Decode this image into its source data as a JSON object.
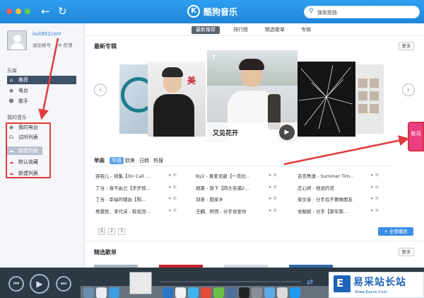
{
  "window": {
    "title": "酷狗音乐",
    "logo_letter": "K",
    "search_placeholder": "搜索歌曲"
  },
  "user": {
    "name": "liuli952com",
    "logout": "退出帐号",
    "feedback": "反馈"
  },
  "sidebar": {
    "library_title": "乐库",
    "library_items": [
      {
        "label": "推荐",
        "icon": "home-icon"
      },
      {
        "label": "电台",
        "icon": "radio-icon"
      },
      {
        "label": "歌手",
        "icon": "singer-icon"
      }
    ],
    "music_title": "我的音乐",
    "music_items": [
      {
        "label": "我的电台",
        "icon": "radio-icon"
      },
      {
        "label": "试听列表",
        "icon": "headphones-icon"
      },
      {
        "label": "新建列表",
        "icon": "cloud-icon"
      },
      {
        "label": "默认收藏",
        "icon": "cloud-icon"
      },
      {
        "label": "新建列表",
        "icon": "cloud-icon"
      }
    ]
  },
  "tabs": [
    "最新推荐",
    "排行榜",
    "精选歌单",
    "专辑"
  ],
  "albums_section": {
    "title": "最新专辑",
    "more": "更多",
    "featured_caption": "又见花开",
    "cover_char": "美"
  },
  "side_tab": "歌词",
  "songs_section": {
    "title": "单曲",
    "filters": [
      "华语",
      "欧美",
      "日韩",
      "热搜"
    ],
    "songs": [
      [
        "容祖儿 - 续集【On Call ...",
        "By2 - 真爱无敌【一克拉...",
        "吉克隽逸 - Summer Tim..."
      ],
      [
        "丁当 - 身不由己【步步惊...",
        "胡夏 - 放下【四大名捕2...",
        "庄心妍 - 他说的谎"
      ],
      [
        "丁当 - 幸福的理由【购...",
        "羽泉 - 陌家乡",
        "梁文音 - 分手后不要做朋友"
      ],
      [
        "吴莫愁、李代沫 - 取名回...",
        "王麟、阿悄 - 分手说爱你",
        "张靓颖 - 分手【那年那..."
      ]
    ],
    "pages": [
      "1",
      "2",
      "3"
    ],
    "play_all": "全部播放"
  },
  "playlists_section": {
    "title": "精选歌单",
    "more": "更多"
  },
  "watermark": {
    "title": "易采站长站",
    "url": "Www.Easck.Com"
  },
  "colors": {
    "titlebar": "#2f9ef0",
    "accent_blue": "#3b8fe5",
    "annotation_red": "#e23b3b",
    "pink": "#e84080",
    "player_bg": "#2d3945"
  }
}
